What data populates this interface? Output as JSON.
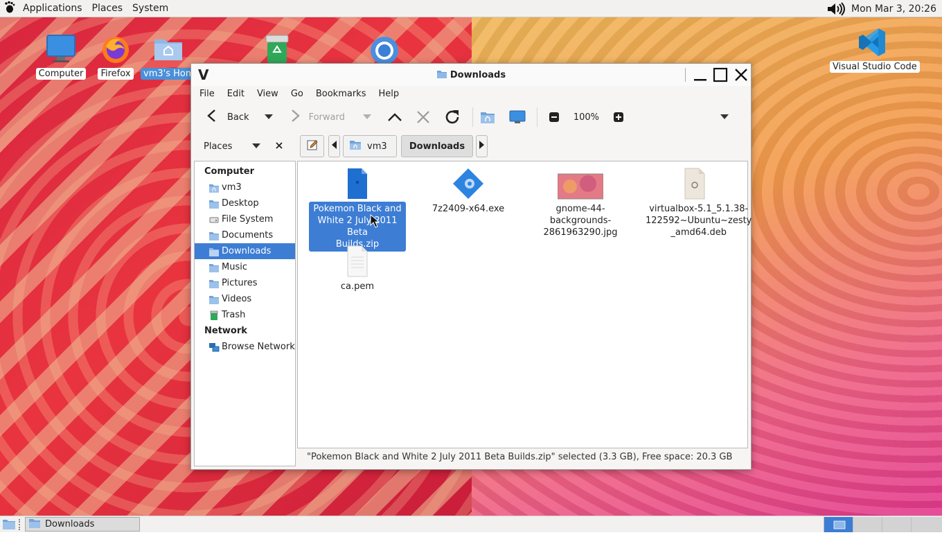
{
  "top_panel": {
    "menus": [
      "Applications",
      "Places",
      "System"
    ],
    "icons": {
      "logo": "gnome-foot-icon",
      "volume": "speaker-icon"
    },
    "clock": "Mon Mar  3, 20:26"
  },
  "desktop": {
    "icons": [
      {
        "label": "Computer",
        "icon": "computer-icon"
      },
      {
        "label": "Firefox",
        "icon": "firefox-icon"
      },
      {
        "label": "vm3's Hom",
        "icon": "home-folder-icon",
        "selected": true
      },
      {
        "label": "",
        "icon": "trash-icon"
      },
      {
        "label": "",
        "icon": "chrome-icon"
      },
      {
        "label": "Visual Studio Code",
        "icon": "vscode-icon"
      }
    ]
  },
  "window": {
    "logo": "V",
    "title": "Downloads",
    "controls": [
      "minimize-icon",
      "maximize-icon",
      "close-icon"
    ],
    "menus": [
      "File",
      "Edit",
      "View",
      "Go",
      "Bookmarks",
      "Help"
    ],
    "toolbar": {
      "back": "Back",
      "forward": "Forward",
      "zoom": "100%"
    },
    "location": {
      "places_label": "Places",
      "path": [
        "vm3",
        "Downloads"
      ]
    },
    "sidebar": {
      "computer_header": "Computer",
      "computer_items": [
        {
          "label": "vm3",
          "icon": "home-folder-icon"
        },
        {
          "label": "Desktop",
          "icon": "folder-icon"
        },
        {
          "label": "File System",
          "icon": "drive-icon"
        },
        {
          "label": "Documents",
          "icon": "folder-icon"
        },
        {
          "label": "Downloads",
          "icon": "folder-icon",
          "selected": true
        },
        {
          "label": "Music",
          "icon": "folder-icon"
        },
        {
          "label": "Pictures",
          "icon": "folder-icon"
        },
        {
          "label": "Videos",
          "icon": "folder-icon"
        },
        {
          "label": "Trash",
          "icon": "trash-icon"
        }
      ],
      "network_header": "Network",
      "network_items": [
        {
          "label": "Browse Network",
          "icon": "network-icon"
        }
      ]
    },
    "files": [
      {
        "name": "Pokemon Black and White 2 July 2011 Beta Builds.zip",
        "lines": [
          "Pokemon Black and",
          "White 2 July 2011 Beta",
          "Builds.zip"
        ],
        "icon": "zip-file-icon",
        "selected": true
      },
      {
        "name": "7z2409-x64.exe",
        "lines": [
          "7z2409-x64.exe"
        ],
        "icon": "exe-file-icon"
      },
      {
        "name": "gnome-44-backgrounds-2861963290.jpg",
        "lines": [
          "gnome-44-",
          "backgrounds-",
          "2861963290.jpg"
        ],
        "icon": "image-thumbnail-icon"
      },
      {
        "name": "virtualbox-5.1_5.1.38-122592~Ubuntu~zesty_amd64.deb",
        "lines": [
          "virtualbox-5.1_5.1.38-",
          "122592~Ubuntu~zesty",
          "_amd64.deb"
        ],
        "icon": "deb-package-icon"
      },
      {
        "name": "ca.pem",
        "lines": [
          "ca.pem"
        ],
        "icon": "text-file-icon"
      }
    ],
    "status": "\"Pokemon Black and White 2 July 2011 Beta Builds.zip\" selected (3.3 GB), Free space: 20.3 GB"
  },
  "bottom_panel": {
    "task": "Downloads"
  },
  "colors": {
    "selection": "#3d7dd4",
    "folder_blue": "#6fa3d8"
  }
}
